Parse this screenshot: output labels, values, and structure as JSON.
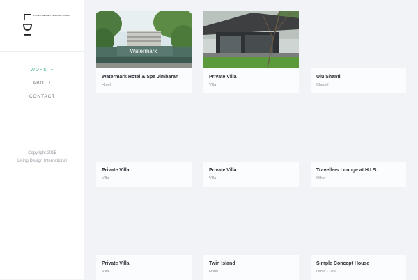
{
  "brand": {
    "logo_text": "LDI",
    "tagline": "LIVING DESIGN INTERNATIONAL"
  },
  "nav": {
    "work": "WORK",
    "work_plus": "+",
    "about": "ABOUT",
    "contact": "CONTACT"
  },
  "footer": {
    "copyright": "Copyright 2015",
    "company": "Living Design International"
  },
  "colors": {
    "accent": "#33b38a",
    "background": "#f1f3f6"
  },
  "projects": [
    {
      "title": "Watermark Hotel & Spa Jimbaran",
      "category": "Hotel",
      "image": "hotel-photo",
      "sign_text": "Watermark"
    },
    {
      "title": "Private Villa",
      "category": "Villa",
      "image": "villa-photo"
    },
    {
      "title": "Ulu Shanti",
      "category": "Chapel"
    },
    {
      "title": "Private Villa",
      "category": "Villa"
    },
    {
      "title": "Private Villa",
      "category": "Villa"
    },
    {
      "title": "Travellers Lounge at H.I.S.",
      "category": "Other"
    },
    {
      "title": "Private Villa",
      "category": "Villa"
    },
    {
      "title": "Twin Island",
      "category": "Hotel"
    },
    {
      "title": "Simple Concept House",
      "category": "Other · Villa"
    }
  ]
}
